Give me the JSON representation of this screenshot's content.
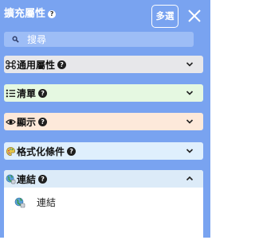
{
  "header": {
    "title": "擴充屬性",
    "help": "?",
    "multi_select_label": "多選"
  },
  "search": {
    "placeholder": "搜尋"
  },
  "sections": [
    {
      "label": "通用屬性",
      "icon": "command-icon",
      "expanded": false
    },
    {
      "label": "清單",
      "icon": "list-icon",
      "expanded": false
    },
    {
      "label": "顯示",
      "icon": "eye-icon",
      "expanded": false
    },
    {
      "label": "格式化條件",
      "icon": "palette-icon",
      "expanded": false
    },
    {
      "label": "連結",
      "icon": "globe-icon",
      "expanded": true,
      "items": [
        {
          "label": "連結",
          "icon": "globe-icon"
        }
      ]
    }
  ],
  "colors": {
    "panel_bg": "#79a3f0",
    "general_bg": "#e7e7ea",
    "list_bg": "#e5f8e1",
    "display_bg": "#fde9da",
    "cond_bg": "#dfeffd",
    "links_bg": "#dcebf8"
  }
}
